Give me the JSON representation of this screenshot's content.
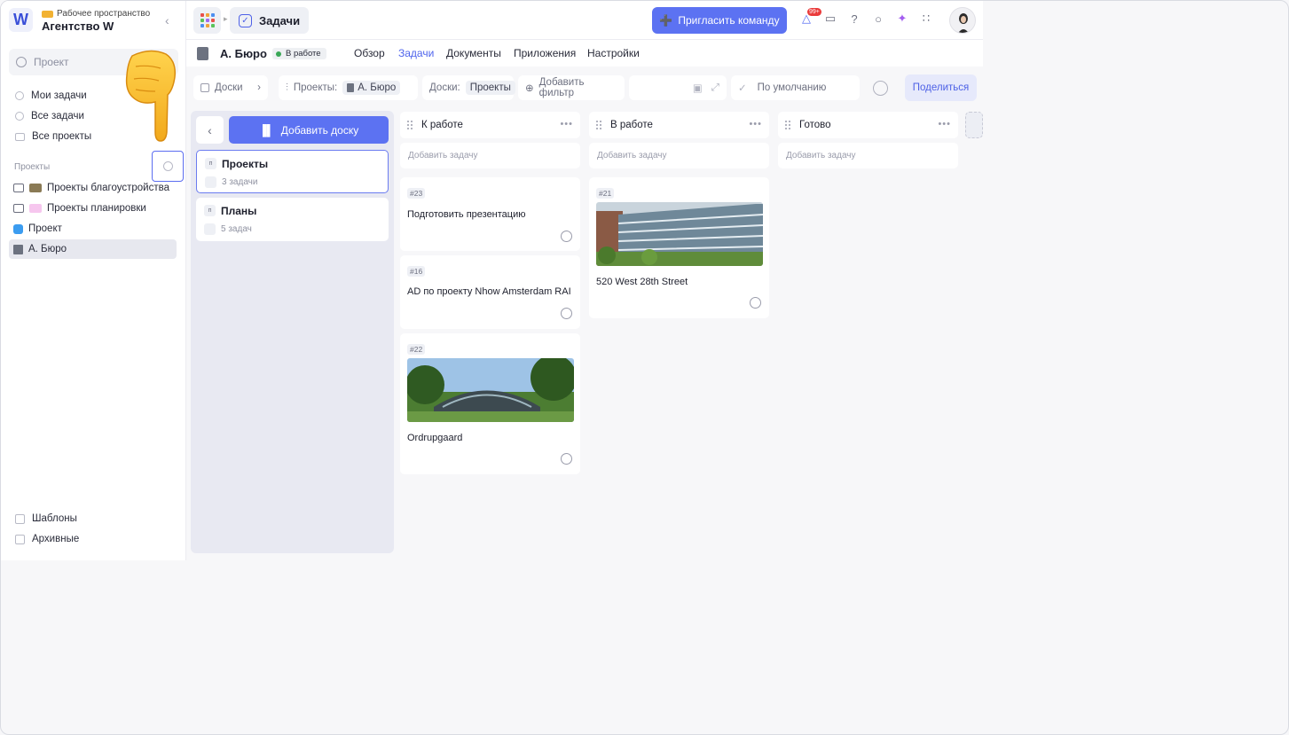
{
  "workspace": {
    "subtitle": "Рабочее пространство",
    "name": "Агентство W",
    "logo": "W"
  },
  "sidebar": {
    "search_placeholder": "Проект",
    "nav": [
      "Мои задачи",
      "Все задачи",
      "Все проекты"
    ],
    "projects_label": "Проекты",
    "projects": [
      {
        "label": "Проекты благоустройства"
      },
      {
        "label": "Проекты планировки"
      },
      {
        "label": "Проект"
      },
      {
        "label": "А. Бюро"
      }
    ],
    "bottom": [
      "Шаблоны",
      "Архивные"
    ]
  },
  "topbar": {
    "breadcrumb": "Задачи",
    "invite_label": "Пригласить команду",
    "notif_count": "99+"
  },
  "project": {
    "name": "А. Бюро",
    "status": "В работе",
    "tabs": [
      "Обзор",
      "Задачи",
      "Документы",
      "Приложения",
      "Настройки"
    ]
  },
  "filters": {
    "boards_label": "Доски",
    "projects_prefix": "Проекты:",
    "projects_value": "А. Бюро",
    "boards_prefix": "Доски:",
    "boards_value": "Проекты",
    "add_filter": "Добавить фильтр",
    "sort_label": "По умолчанию",
    "share_label": "Поделиться"
  },
  "boards_panel": {
    "add_board": "Добавить доску",
    "boards": [
      {
        "letter": "п",
        "name": "Проекты",
        "count": "3 задачи"
      },
      {
        "letter": "п",
        "name": "Планы",
        "count": "5 задач"
      }
    ]
  },
  "columns": [
    {
      "title": "К работе",
      "add_task": "Добавить задачу",
      "tasks": [
        {
          "num": "#23",
          "title": "Подготовить презентацию"
        },
        {
          "num": "#16",
          "title": "AD по проекту Nhow Amsterdam RAI"
        },
        {
          "num": "#22",
          "title": "Ordrupgaard"
        }
      ]
    },
    {
      "title": "В работе",
      "add_task": "Добавить задачу",
      "tasks": [
        {
          "num": "#21",
          "title": "520 West 28th Street"
        }
      ]
    },
    {
      "title": "Готово",
      "add_task": "Добавить задачу",
      "tasks": []
    }
  ],
  "colors": {
    "accent": "#5c72f2",
    "active_tab": "#5065ec",
    "status_dot": "#3aa757"
  }
}
